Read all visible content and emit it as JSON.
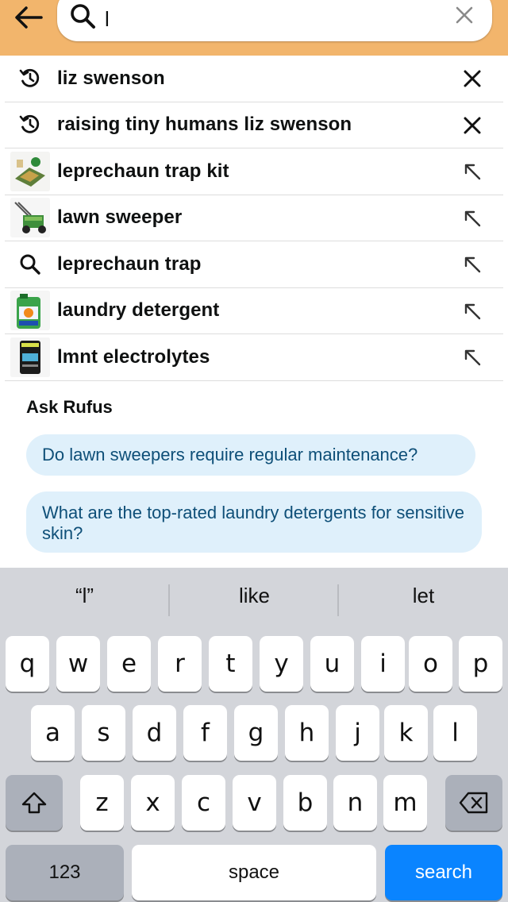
{
  "search": {
    "query": "l",
    "back_icon": "back-arrow-icon",
    "search_icon": "search-icon",
    "clear_icon": "clear-icon"
  },
  "suggestions": [
    {
      "label": "liz swenson",
      "lead": "history-icon",
      "trail": "remove-icon"
    },
    {
      "label": "raising tiny humans liz swenson",
      "lead": "history-icon",
      "trail": "remove-icon"
    },
    {
      "label": "leprechaun trap kit",
      "lead": "product-thumbnail",
      "trail": "fill-query-arrow-icon"
    },
    {
      "label": "lawn sweeper",
      "lead": "product-thumbnail",
      "trail": "fill-query-arrow-icon"
    },
    {
      "label": "leprechaun trap",
      "lead": "search-icon",
      "trail": "fill-query-arrow-icon"
    },
    {
      "label": "laundry detergent",
      "lead": "product-thumbnail",
      "trail": "fill-query-arrow-icon"
    },
    {
      "label": "lmnt electrolytes",
      "lead": "product-thumbnail",
      "trail": "fill-query-arrow-icon"
    }
  ],
  "rufus": {
    "title": "Ask Rufus",
    "questions": [
      "Do lawn sweepers require regular maintenance?",
      "What are the top-rated laundry detergents for sensitive skin?"
    ]
  },
  "keyboard": {
    "predictions": [
      "“l”",
      "like",
      "let"
    ],
    "row1": [
      "q",
      "w",
      "e",
      "r",
      "t",
      "y",
      "u",
      "i",
      "o",
      "p"
    ],
    "row2": [
      "a",
      "s",
      "d",
      "f",
      "g",
      "h",
      "j",
      "k",
      "l"
    ],
    "row3": [
      "z",
      "x",
      "c",
      "v",
      "b",
      "n",
      "m"
    ],
    "numbers_label": "123",
    "space_label": "space",
    "search_label": "search"
  },
  "colors": {
    "header_bg": "#f2b56c",
    "pill_bg": "#dff0fb",
    "pill_text": "#0e4f78",
    "keyboard_bg": "#d3d5da",
    "search_key": "#0a84ff"
  }
}
